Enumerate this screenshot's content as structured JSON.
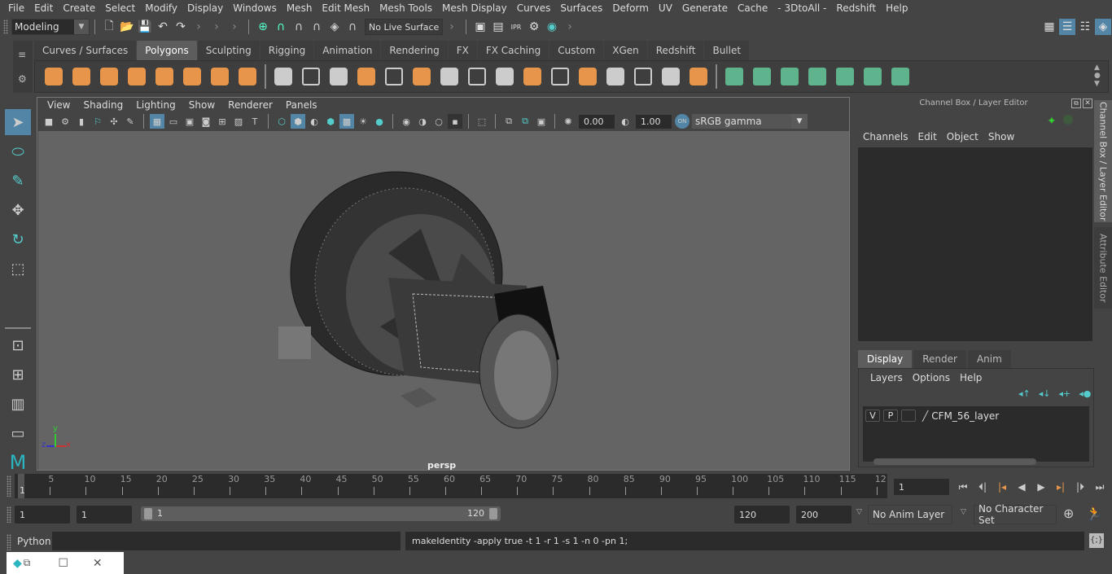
{
  "menubar": {
    "items": [
      "File",
      "Edit",
      "Create",
      "Select",
      "Modify",
      "Display",
      "Windows",
      "Mesh",
      "Edit Mesh",
      "Mesh Tools",
      "Mesh Display",
      "Curves",
      "Surfaces",
      "Deform",
      "UV",
      "Generate",
      "Cache",
      "- 3DtoAll -",
      "Redshift",
      "Help"
    ]
  },
  "statusline": {
    "mode": "Modeling",
    "live_surface": "No Live Surface"
  },
  "shelf": {
    "tabs": [
      "Curves / Surfaces",
      "Polygons",
      "Sculpting",
      "Rigging",
      "Animation",
      "Rendering",
      "FX",
      "FX Caching",
      "Custom",
      "XGen",
      "Redshift",
      "Bullet"
    ],
    "active_tab": "Polygons",
    "icons": [
      "poly-sphere-icon",
      "poly-cube-icon",
      "poly-cylinder-icon",
      "poly-cone-icon",
      "poly-plane-icon",
      "poly-torus-icon",
      "poly-pyramid-icon",
      "poly-pipe-icon",
      "combine-icon",
      "separate-icon",
      "mirror-icon",
      "smooth-icon",
      "bevel-icon",
      "extrude-icon",
      "bridge-icon",
      "fill-hole-icon",
      "multi-cut-icon",
      "target-weld-icon",
      "insert-edge-loop-icon",
      "make-live-icon",
      "quad-draw-icon",
      "append-to-polygon-icon",
      "offset-edge-loop-icon",
      "merge-icon",
      "uv-planar-icon",
      "uv-cylindrical-icon",
      "uv-spherical-icon",
      "uv-automatic-icon",
      "uv-unfold-icon",
      "uv-editor-icon",
      "uv-cut-sew-icon"
    ]
  },
  "viewport": {
    "menu": [
      "View",
      "Shading",
      "Lighting",
      "Show",
      "Renderer",
      "Panels"
    ],
    "exposure": "0.00",
    "gamma": "1.00",
    "color_mgmt_badge": "ON",
    "color_space": "sRGB gamma",
    "camera": "persp",
    "axis": {
      "x": "x",
      "y": "y",
      "z": "z"
    }
  },
  "channel_box": {
    "title": "Channel Box / Layer Editor",
    "menu": [
      "Channels",
      "Edit",
      "Object",
      "Show"
    ]
  },
  "layer_editor": {
    "tabs": [
      "Display",
      "Render",
      "Anim"
    ],
    "active_tab": "Display",
    "menu": [
      "Layers",
      "Options",
      "Help"
    ],
    "layers": [
      {
        "v": "V",
        "p": "P",
        "name": "CFM_56_layer"
      }
    ]
  },
  "side_tabs": [
    "Channel Box / Layer Editor",
    "Attribute Editor"
  ],
  "timeline": {
    "ticks": [
      "5",
      "10",
      "15",
      "20",
      "25",
      "30",
      "35",
      "40",
      "45",
      "50",
      "55",
      "60",
      "65",
      "70",
      "75",
      "80",
      "85",
      "90",
      "95",
      "100",
      "105",
      "110",
      "115",
      "12"
    ],
    "start_marker": "1",
    "current_frame": "1",
    "range_start": 1,
    "range_end": 120
  },
  "range": {
    "start": "1",
    "playback_start": "1",
    "slider_start": "1",
    "slider_end": "120",
    "playback_end": "120",
    "end": "200",
    "anim_layer": "No Anim Layer",
    "character_set": "No Character Set"
  },
  "command": {
    "language": "Python",
    "input": "",
    "result": "makeIdentity -apply true -t 1 -r 1 -s 1 -n 0 -pn 1;"
  }
}
